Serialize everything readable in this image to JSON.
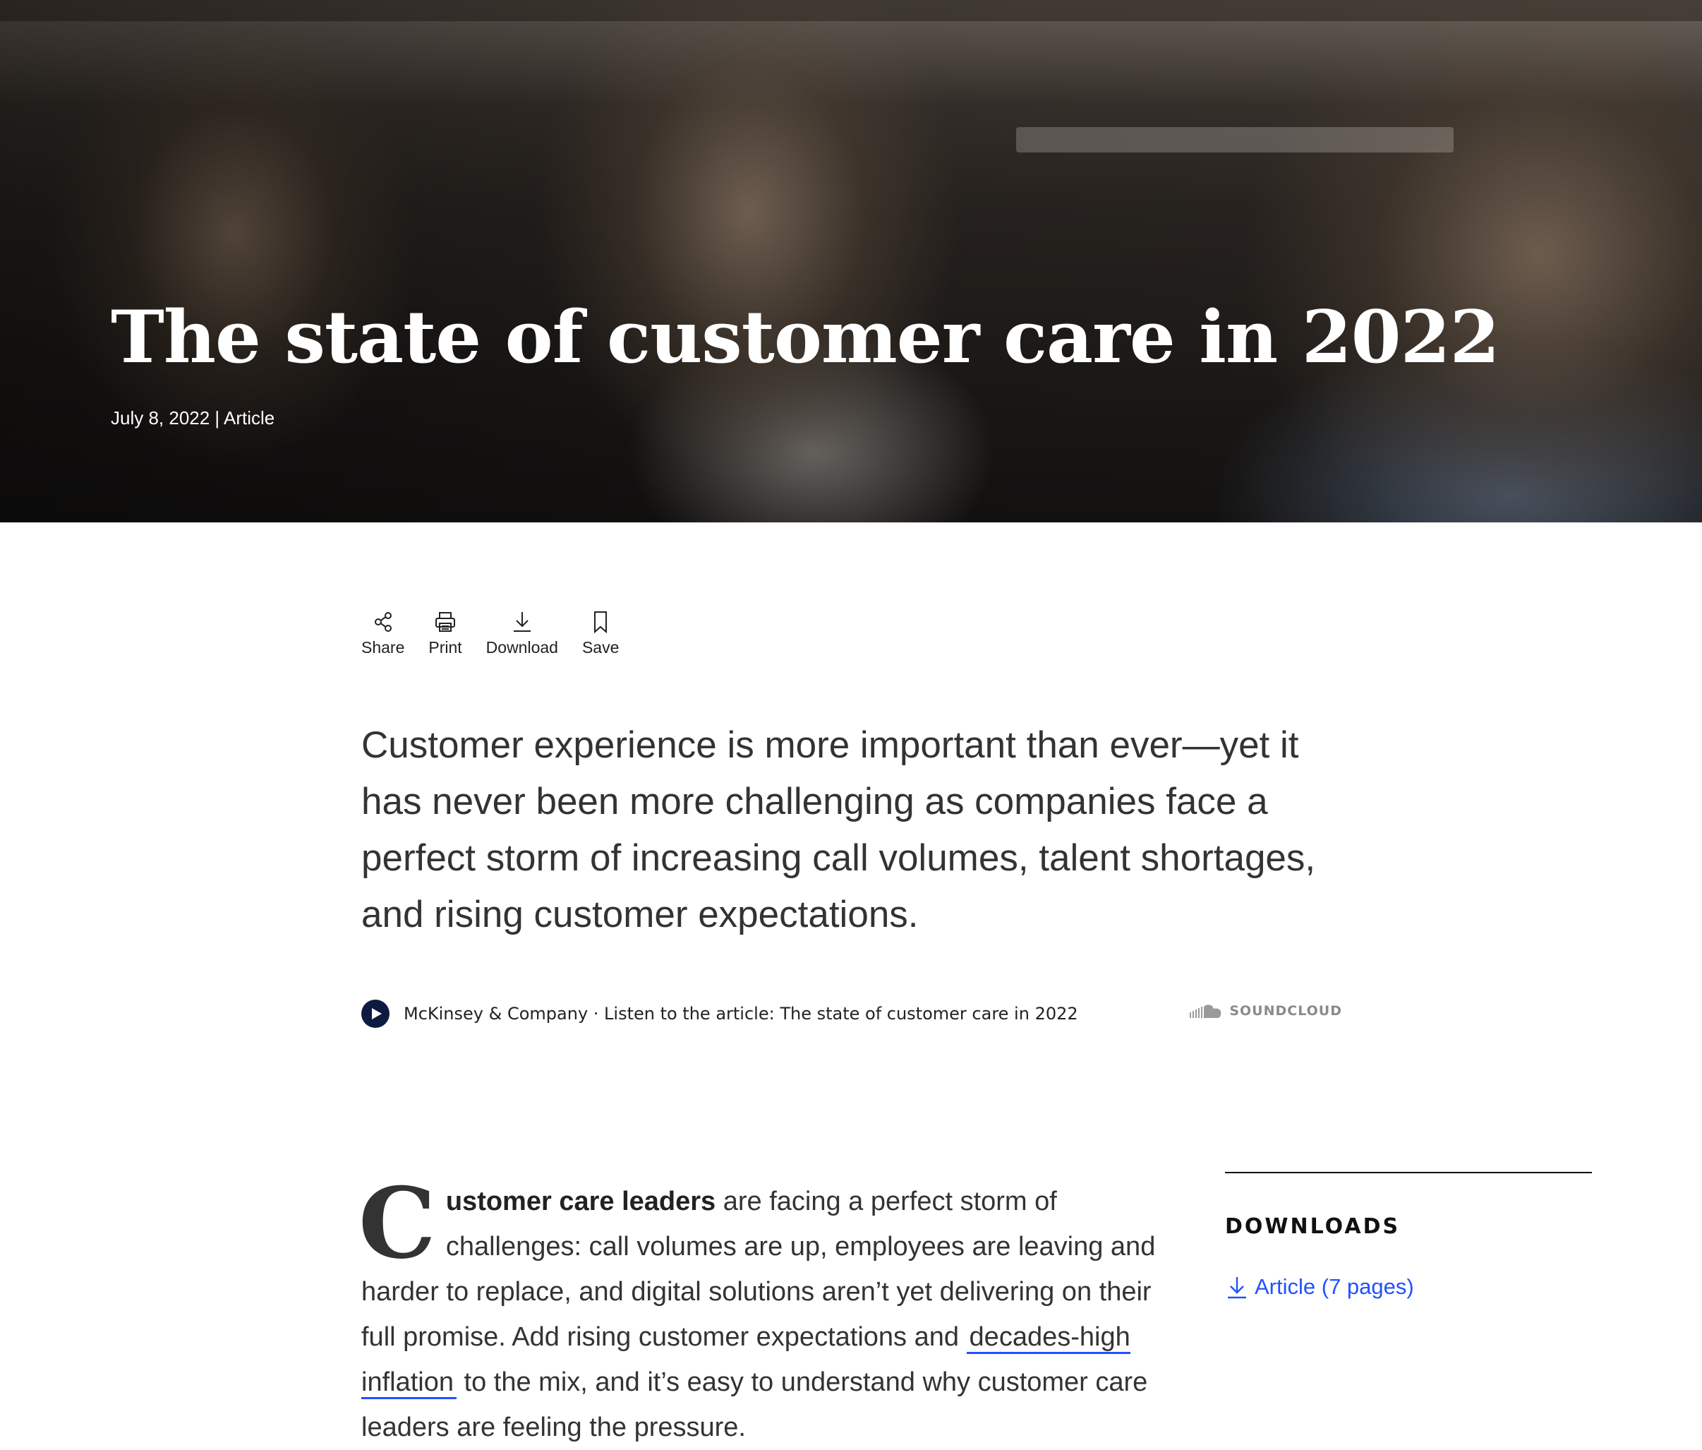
{
  "hero": {
    "title": "The state of customer care in 2022",
    "meta": "July 8, 2022 | Article"
  },
  "toolbar": {
    "share_label": "Share",
    "print_label": "Print",
    "download_label": "Download",
    "save_label": "Save"
  },
  "lead": "Customer experience is more important than ever—yet it has never been more challenging as companies face a perfect storm of increasing call volumes, talent shortages, and rising customer expectations.",
  "audio": {
    "title": "McKinsey & Company · Listen to the article: The state of customer care in 2022",
    "provider": "SOUNDCLOUD"
  },
  "body": {
    "dropcap": "C",
    "bold_lead": "ustomer care leaders",
    "text_1": " are facing a perfect storm of challenges: call volumes are up, employees are leaving and harder to replace, and digital solutions aren’t yet delivering on their full promise. Add rising customer expectations and ",
    "link_text": "decades-high inflation",
    "text_2": " to the mix, and it’s easy to understand why customer care leaders are feeling the pressure."
  },
  "sidebar": {
    "heading": "DOWNLOADS",
    "download_item": "Article (7 pages)"
  },
  "colors": {
    "link": "#2251ff",
    "play_button": "#0c1b3f",
    "text": "#333333"
  }
}
